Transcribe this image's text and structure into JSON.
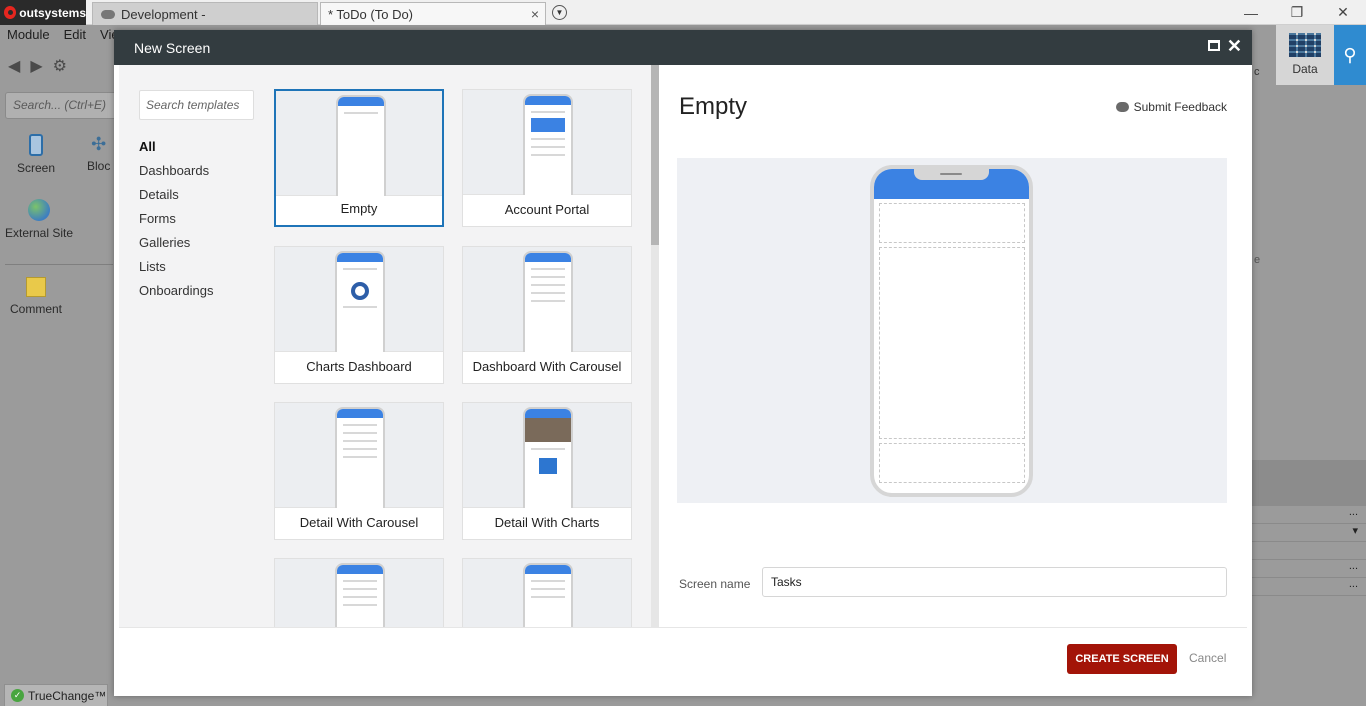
{
  "app": {
    "logo_text": "outsystems",
    "env_tab": "Development -",
    "doc_tab": "* ToDo (To Do)",
    "win": {
      "minimize": "—",
      "restore": "❐",
      "close": "✕"
    }
  },
  "menubar": [
    "Module",
    "Edit",
    "Vie"
  ],
  "left": {
    "search_placeholder": "Search... (Ctrl+E)",
    "tools": [
      {
        "label": "Screen",
        "icon": "phone-icon"
      },
      {
        "label": "Bloc",
        "icon": "block-icon"
      },
      {
        "label": "External Site",
        "icon": "globe-icon"
      },
      {
        "label": "Comment",
        "icon": "note-icon"
      }
    ]
  },
  "right": {
    "data_tab": "Data",
    "partial_letters": [
      "c",
      "e"
    ],
    "row_markers": [
      "...",
      "▾",
      "...",
      "..."
    ]
  },
  "status": {
    "truechange": "TrueChange™"
  },
  "dialog": {
    "title": "New Screen",
    "search_placeholder": "Search templates",
    "categories": [
      "All",
      "Dashboards",
      "Details",
      "Forms",
      "Galleries",
      "Lists",
      "Onboardings"
    ],
    "selected_category": "All",
    "templates": [
      {
        "label": "Empty",
        "selected": true
      },
      {
        "label": "Account Portal",
        "selected": false
      },
      {
        "label": "Charts Dashboard",
        "selected": false
      },
      {
        "label": "Dashboard With Carousel",
        "selected": false
      },
      {
        "label": "Detail With Carousel",
        "selected": false
      },
      {
        "label": "Detail With Charts",
        "selected": false
      },
      {
        "label": "",
        "selected": false
      },
      {
        "label": "",
        "selected": false
      }
    ],
    "preview": {
      "title": "Empty",
      "feedback": "Submit Feedback"
    },
    "screen_name_label": "Screen name",
    "screen_name_value": "Tasks",
    "create_label": "CREATE SCREEN",
    "cancel_label": "Cancel",
    "colors": {
      "title_bar": "#333c40",
      "accent": "#3b82e3",
      "create_btn": "#a31408",
      "selected_border": "#1e74b8"
    }
  }
}
